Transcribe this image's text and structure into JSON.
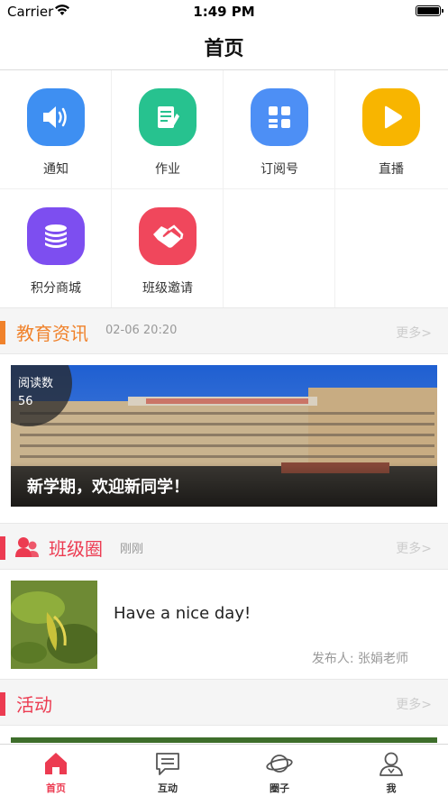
{
  "status_bar": {
    "carrier": "Carrier",
    "time": "1:49 PM"
  },
  "navbar": {
    "title": "首页"
  },
  "grid": {
    "items": [
      {
        "label": "通知",
        "icon": "speaker-icon",
        "color": "#3e8ff2"
      },
      {
        "label": "作业",
        "icon": "homework-icon",
        "color": "#27c28f"
      },
      {
        "label": "订阅号",
        "icon": "grid-icon",
        "color": "#4d8ff5"
      },
      {
        "label": "直播",
        "icon": "play-icon",
        "color": "#f8b500"
      },
      {
        "label": "积分商城",
        "icon": "coins-icon",
        "color": "#7d4ef0"
      },
      {
        "label": "班级邀请",
        "icon": "handshake-icon",
        "color": "#f0475c"
      }
    ]
  },
  "news_section": {
    "title": "教育资讯",
    "time": "02-06 20:20",
    "more": "更多>",
    "accent": "#f0822b"
  },
  "news_card": {
    "read_label": "阅读数",
    "read_count": "56",
    "caption": "新学期，欢迎新同学！"
  },
  "class_section": {
    "title": "班级圈",
    "time": "刚刚",
    "more": "更多>",
    "accent": "#ec3b51"
  },
  "post": {
    "text": "Have a nice day!",
    "author": "发布人: 张娟老师"
  },
  "activity_section": {
    "title": "活动",
    "more": "更多>",
    "accent": "#ec3b51"
  },
  "tabbar": {
    "tabs": [
      {
        "label": "首页",
        "icon": "home-icon",
        "active": true
      },
      {
        "label": "互动",
        "icon": "chat-icon",
        "active": false
      },
      {
        "label": "圈子",
        "icon": "planet-icon",
        "active": false
      },
      {
        "label": "我",
        "icon": "profile-icon",
        "active": false
      }
    ]
  }
}
